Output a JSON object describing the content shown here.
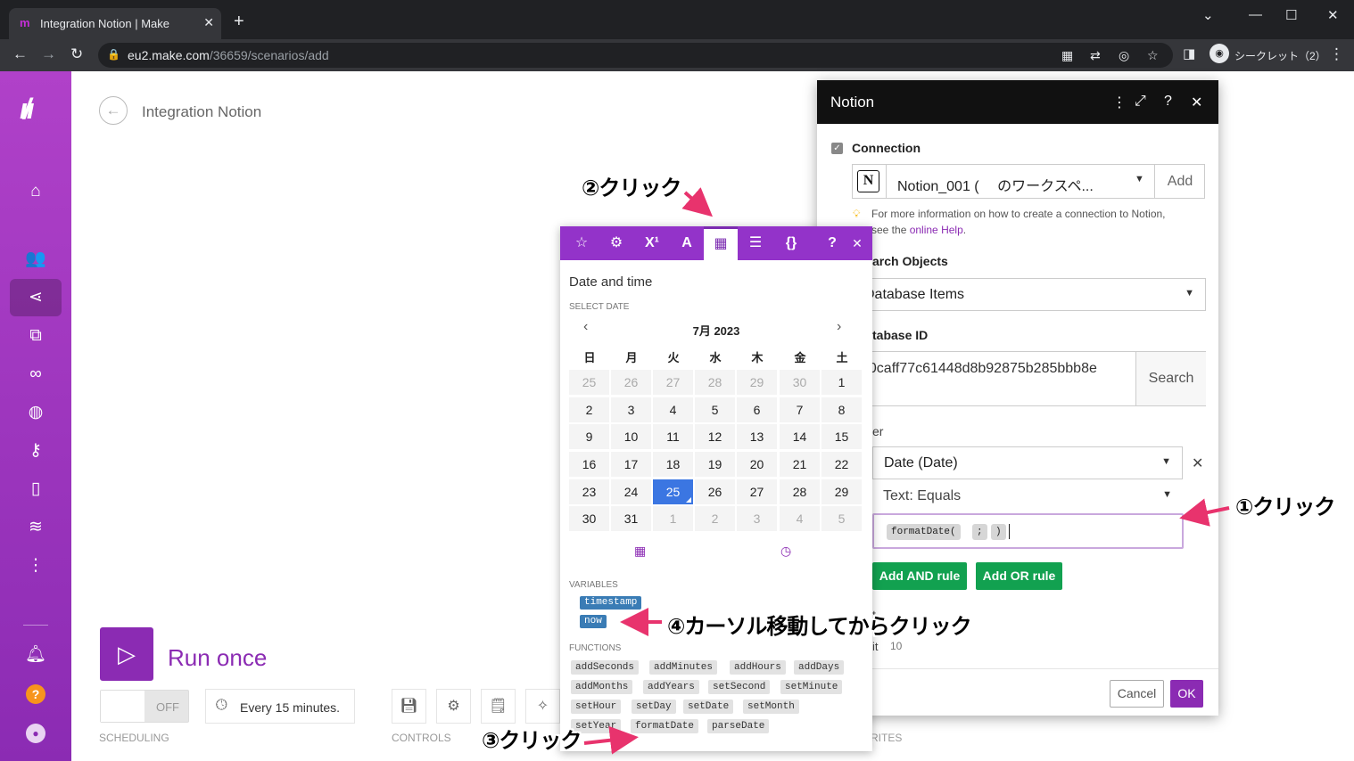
{
  "browser": {
    "tab_title": "Integration Notion | Make",
    "tab_favicon": "make-logo-icon",
    "url_host": "eu2.make.com",
    "url_path": "/36659/scenarios/add",
    "incognito_label": "シークレット（2）"
  },
  "scenario": {
    "title": "Integration Notion",
    "run_once_label": "Run once",
    "toggle_state": "OFF",
    "schedule_text": "Every 15 minutes.",
    "scheduling_label": "SCHEDULING",
    "controls_label": "CONTROLS",
    "favorites_label": "RITES"
  },
  "notion_dialog": {
    "title": "Notion",
    "connection_label": "Connection",
    "connection_value": "Notion_001 (　 のワークスペ...",
    "add_label": "Add",
    "hint_text": "For more information on how to create a connection to Notion,",
    "hint_see": "see the ",
    "hint_link": "online Help",
    "hint_end": ".",
    "search_objects_label": "arch Objects",
    "search_objects_value": "Database Items",
    "database_id_label": "tabase ID",
    "database_id_value": "50caff77c61448d8b92875b285bbb8e",
    "database_id_overflow": "5",
    "search_button": "Search",
    "filter_label": "er",
    "filter_field_value": "Date (Date)",
    "filter_operator_value": "Text: Equals",
    "formula_tokens": [
      "formatDate(",
      ";",
      ")"
    ],
    "add_and_rule": "Add AND rule",
    "add_or_rule": "Add OR rule",
    "partial_label_1": "t",
    "partial_label_2": "it",
    "limit_value": "10",
    "cancel_label": "Cancel",
    "ok_label": "OK"
  },
  "picker": {
    "tabs": [
      "star-icon",
      "gear-icon",
      "superscript-icon",
      "text-icon",
      "calendar-icon",
      "table-icon",
      "braces-icon"
    ],
    "active_tab": "calendar-icon",
    "help_label": "?",
    "close_label": "✕",
    "section_title": "Date and time",
    "select_date_label": "SELECT DATE",
    "month_label": "7月 2023",
    "weekdays": [
      "日",
      "月",
      "火",
      "水",
      "木",
      "金",
      "土"
    ],
    "weeks": [
      [
        "25",
        "26",
        "27",
        "28",
        "29",
        "30",
        "1"
      ],
      [
        "2",
        "3",
        "4",
        "5",
        "6",
        "7",
        "8"
      ],
      [
        "9",
        "10",
        "11",
        "12",
        "13",
        "14",
        "15"
      ],
      [
        "16",
        "17",
        "18",
        "19",
        "20",
        "21",
        "22"
      ],
      [
        "23",
        "24",
        "25",
        "26",
        "27",
        "28",
        "29"
      ],
      [
        "30",
        "31",
        "1",
        "2",
        "3",
        "4",
        "5"
      ]
    ],
    "selected_day": "25",
    "variables_label": "VARIABLES",
    "variables": [
      "timestamp",
      "now"
    ],
    "functions_label": "FUNCTIONS",
    "functions": [
      [
        "addSeconds",
        "addMinutes",
        "addHours",
        "addDays"
      ],
      [
        "addMonths",
        "addYears",
        "setSecond",
        "setMinute"
      ],
      [
        "setHour",
        "setDay",
        "setDate",
        "setMonth"
      ],
      [
        "setYear",
        "formatDate",
        "parseDate"
      ]
    ]
  },
  "annotations": {
    "step1": "①クリック",
    "step2": "②クリック",
    "step3": "③クリック",
    "step4": "④カーソル移動してからクリック",
    "arrow_color": "#e8336d"
  },
  "colors": {
    "brand_purple": "#8b2bb3",
    "picker_purple": "#9333c9",
    "rule_green": "#12a150",
    "selected_date_blue": "#3b76e2"
  }
}
